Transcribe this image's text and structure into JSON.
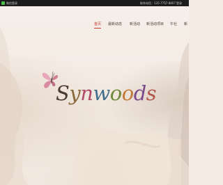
{
  "topbar": {
    "left_text": "微信登录",
    "phone_label": "联系电话：135-7757-8807",
    "separator": "|",
    "login_label": "登录"
  },
  "nav": {
    "items": [
      {
        "label": "首页",
        "active": true
      },
      {
        "label": "最新动态",
        "active": false
      },
      {
        "label": "新活动",
        "active": false
      },
      {
        "label": "新活动项目",
        "active": false
      },
      {
        "label": "午社",
        "active": false
      },
      {
        "label": "新",
        "active": false
      }
    ]
  },
  "brand": {
    "logo_text": "Synwoods",
    "icons": {
      "butterfly": "butterfly-icon",
      "wechat": "wechat-icon"
    }
  },
  "colors": {
    "accent": "#c0392b",
    "topbar_bg": "#1c1c1c",
    "background": "#f3ebe4"
  }
}
